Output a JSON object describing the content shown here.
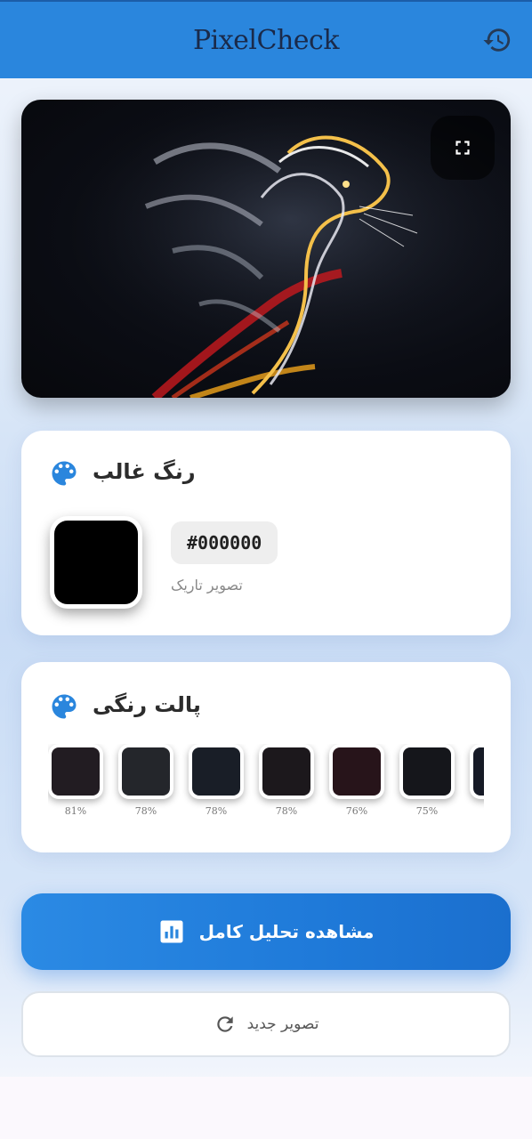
{
  "header": {
    "title": "PixelCheck",
    "history_icon": "history-icon"
  },
  "image": {
    "fullscreen_icon": "fullscreen-icon"
  },
  "dominant": {
    "title": "رنگ غالب",
    "hex": "#000000",
    "tone": "تصویر تاریک",
    "color": "#000000"
  },
  "palette": {
    "title": "پالت رنگی",
    "items": [
      {
        "color": "#221c22",
        "percent": "81%"
      },
      {
        "color": "#24262b",
        "percent": "78%"
      },
      {
        "color": "#191e27",
        "percent": "78%"
      },
      {
        "color": "#1c181c",
        "percent": "78%"
      },
      {
        "color": "#27141a",
        "percent": "76%"
      },
      {
        "color": "#15161b",
        "percent": "75%"
      },
      {
        "color": "#161a26",
        "percent": ""
      }
    ]
  },
  "actions": {
    "full_analysis": "مشاهده تحلیل کامل",
    "new_image": "تصویر جدید"
  },
  "colors": {
    "accent": "#2a86dd",
    "icon_blue": "#2a86dd"
  }
}
